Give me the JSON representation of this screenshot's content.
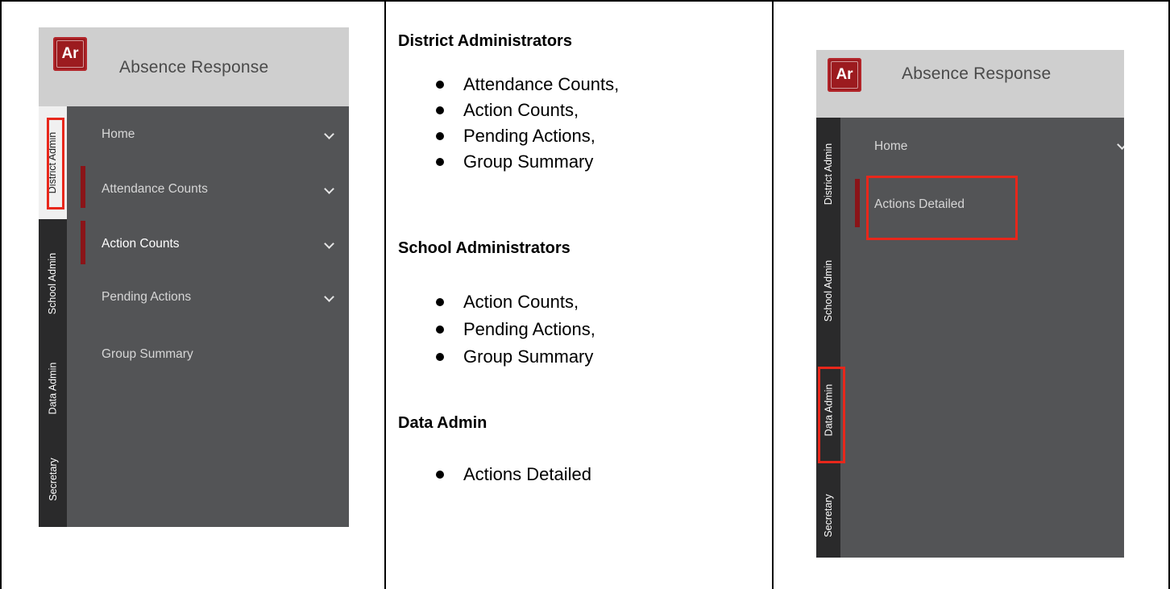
{
  "app": {
    "logo_text": "Ar",
    "title": "Absence Response",
    "brand_color": "#9c1b1f",
    "highlight_color": "#e8271b"
  },
  "left_panel": {
    "roles": [
      "District Admin",
      "School Admin",
      "Data Admin",
      "Secretary"
    ],
    "active_role": "District Admin",
    "highlighted_role": "District Admin",
    "nav_items": [
      {
        "label": "Home",
        "chevron": true
      },
      {
        "label": "Attendance Counts",
        "chevron": true
      },
      {
        "label": "Action Counts",
        "chevron": true,
        "selected": true
      },
      {
        "label": "Pending Actions",
        "chevron": true
      },
      {
        "label": "Group Summary",
        "chevron": false
      }
    ]
  },
  "middle": {
    "sections": [
      {
        "heading": "District Administrators",
        "items": [
          "Attendance Counts,",
          "Action Counts,",
          "Pending Actions,",
          "Group Summary"
        ]
      },
      {
        "heading": "School Administrators",
        "items": [
          "Action Counts,",
          "Pending Actions,",
          "Group Summary"
        ]
      },
      {
        "heading": "Data Admin",
        "items": [
          "Actions Detailed"
        ]
      }
    ]
  },
  "right_panel": {
    "roles": [
      "District Admin",
      "School Admin",
      "Data Admin",
      "Secretary"
    ],
    "highlighted_role": "Data Admin",
    "nav_items": [
      {
        "label": "Home",
        "chevron": true
      },
      {
        "label": "Actions Detailed",
        "chevron": false,
        "highlighted": true
      }
    ]
  }
}
